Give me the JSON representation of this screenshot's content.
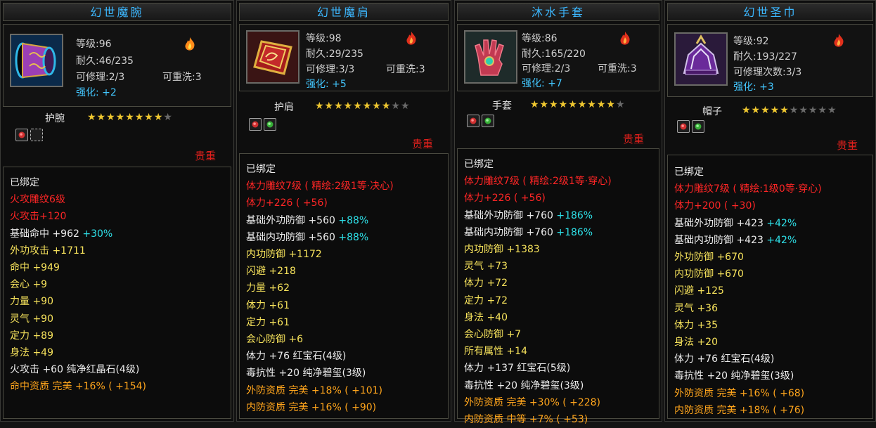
{
  "panels": [
    {
      "title": "幻世魔腕",
      "level": "等级:96",
      "durability": "耐久:46/235",
      "repair": "可修理:2/3",
      "rewash": "可重洗:3",
      "enhance": "强化: +2",
      "slot": "护腕",
      "stars_filled": "★★★★★★★★",
      "stars_empty": "★",
      "rarity": "贵重",
      "bound": "已绑定",
      "lines": [
        {
          "text": "火攻雕纹6级",
          "pct": "",
          "color": "c-red"
        },
        {
          "text": "火攻击+120",
          "pct": "",
          "color": "c-red"
        },
        {
          "text": "基础命中 +962",
          "pct": "+30%",
          "color": "c-white"
        },
        {
          "text": "外功攻击 +1711",
          "pct": "",
          "color": "c-yellow"
        },
        {
          "text": "命中 +949",
          "pct": "",
          "color": "c-yellow"
        },
        {
          "text": "会心 +9",
          "pct": "",
          "color": "c-yellow"
        },
        {
          "text": "力量 +90",
          "pct": "",
          "color": "c-yellow"
        },
        {
          "text": "灵气 +90",
          "pct": "",
          "color": "c-yellow"
        },
        {
          "text": "定力 +89",
          "pct": "",
          "color": "c-yellow"
        },
        {
          "text": "身法 +49",
          "pct": "",
          "color": "c-yellow"
        },
        {
          "text": "火攻击 +60 纯净红晶石(4级)",
          "pct": "",
          "color": "c-white"
        },
        {
          "text": "命中资质  完美 +16% ( +154)",
          "pct": "",
          "color": "c-orange"
        }
      ]
    },
    {
      "title": "幻世魔肩",
      "level": "等级:98",
      "durability": "耐久:29/235",
      "repair": "可修理:3/3",
      "rewash": "可重洗:3",
      "enhance": "强化: +5",
      "slot": "护肩",
      "stars_filled": "★★★★★★★★",
      "stars_empty": "★★",
      "rarity": "贵重",
      "bound": "已绑定",
      "lines": [
        {
          "text": "体力雕纹7级 ( 精绘:2级1等·决心)",
          "pct": "",
          "color": "c-red"
        },
        {
          "text": "体力+226 ( +56)",
          "pct": "",
          "color": "c-red"
        },
        {
          "text": "基础外功防御 +560",
          "pct": "+88%",
          "color": "c-white"
        },
        {
          "text": "基础内功防御 +560",
          "pct": "+88%",
          "color": "c-white"
        },
        {
          "text": "内功防御 +1172",
          "pct": "",
          "color": "c-yellow"
        },
        {
          "text": "闪避 +218",
          "pct": "",
          "color": "c-yellow"
        },
        {
          "text": "力量 +62",
          "pct": "",
          "color": "c-yellow"
        },
        {
          "text": "体力 +61",
          "pct": "",
          "color": "c-yellow"
        },
        {
          "text": "定力 +61",
          "pct": "",
          "color": "c-yellow"
        },
        {
          "text": "会心防御 +6",
          "pct": "",
          "color": "c-yellow"
        },
        {
          "text": "体力 +76 红宝石(4级)",
          "pct": "",
          "color": "c-white"
        },
        {
          "text": "毒抗性 +20 纯净碧玺(3级)",
          "pct": "",
          "color": "c-white"
        },
        {
          "text": "外防资质  完美 +18% ( +101)",
          "pct": "",
          "color": "c-orange"
        },
        {
          "text": "内防资质  完美 +16% ( +90)",
          "pct": "",
          "color": "c-orange"
        }
      ]
    },
    {
      "title": "沐水手套",
      "level": "等级:86",
      "durability": "耐久:165/220",
      "repair": "可修理:2/3",
      "rewash": "可重洗:3",
      "enhance": "强化: +7",
      "slot": "手套",
      "stars_filled": "★★★★★★★★★",
      "stars_empty": "★",
      "rarity": "贵重",
      "bound": "已绑定",
      "lines": [
        {
          "text": "体力雕纹7级 ( 精绘:2级1等·穿心)",
          "pct": "",
          "color": "c-red"
        },
        {
          "text": "体力+226 ( +56)",
          "pct": "",
          "color": "c-red"
        },
        {
          "text": "基础外功防御 +760",
          "pct": "+186%",
          "color": "c-white"
        },
        {
          "text": "基础内功防御 +760",
          "pct": "+186%",
          "color": "c-white"
        },
        {
          "text": "内功防御 +1383",
          "pct": "",
          "color": "c-yellow"
        },
        {
          "text": "灵气 +73",
          "pct": "",
          "color": "c-yellow"
        },
        {
          "text": "体力 +72",
          "pct": "",
          "color": "c-yellow"
        },
        {
          "text": "定力 +72",
          "pct": "",
          "color": "c-yellow"
        },
        {
          "text": "身法 +40",
          "pct": "",
          "color": "c-yellow"
        },
        {
          "text": "会心防御 +7",
          "pct": "",
          "color": "c-yellow"
        },
        {
          "text": "所有属性 +14",
          "pct": "",
          "color": "c-yellow"
        },
        {
          "text": "体力 +137 红宝石(5级)",
          "pct": "",
          "color": "c-white"
        },
        {
          "text": "毒抗性 +20 纯净碧玺(3级)",
          "pct": "",
          "color": "c-white"
        },
        {
          "text": "外防资质  完美 +30% ( +228)",
          "pct": "",
          "color": "c-orange"
        },
        {
          "text": "内防资质  中等 +7% ( +53)",
          "pct": "",
          "color": "c-orange"
        }
      ]
    },
    {
      "title": "幻世圣巾",
      "level": "等级:92",
      "durability": "耐久:193/227",
      "repair": "可修理次数:3/3",
      "rewash": "",
      "enhance": "强化: +3",
      "slot": "帽子",
      "stars_filled": "★★★★★",
      "stars_empty": "★★★★★",
      "rarity": "贵重",
      "bound": "已绑定",
      "lines": [
        {
          "text": "体力雕纹7级 ( 精绘:1级0等·穿心)",
          "pct": "",
          "color": "c-red"
        },
        {
          "text": "体力+200 ( +30)",
          "pct": "",
          "color": "c-red"
        },
        {
          "text": "基础外功防御 +423",
          "pct": "+42%",
          "color": "c-white"
        },
        {
          "text": "基础内功防御 +423",
          "pct": "+42%",
          "color": "c-white"
        },
        {
          "text": "外功防御 +670",
          "pct": "",
          "color": "c-yellow"
        },
        {
          "text": "内功防御 +670",
          "pct": "",
          "color": "c-yellow"
        },
        {
          "text": "闪避 +125",
          "pct": "",
          "color": "c-yellow"
        },
        {
          "text": "灵气 +36",
          "pct": "",
          "color": "c-yellow"
        },
        {
          "text": "体力 +35",
          "pct": "",
          "color": "c-yellow"
        },
        {
          "text": "身法 +20",
          "pct": "",
          "color": "c-yellow"
        },
        {
          "text": "体力 +76 红宝石(4级)",
          "pct": "",
          "color": "c-white"
        },
        {
          "text": "毒抗性 +20 纯净碧玺(3级)",
          "pct": "",
          "color": "c-white"
        },
        {
          "text": "外防资质  完美 +16% ( +68)",
          "pct": "",
          "color": "c-orange"
        },
        {
          "text": "内防资质  完美 +18% ( +76)",
          "pct": "",
          "color": "c-orange"
        }
      ]
    }
  ],
  "colors": {
    "title": "#3cb7ff",
    "enhance": "#43c7ff",
    "rarity": "#e0201c",
    "stat_yellow": "#f7e35c",
    "stat_red": "#ff2626",
    "aptitude": "#ffa51c",
    "percent": "#2ee0e8"
  },
  "icons": [
    "bracer-item-icon",
    "pauldron-item-icon",
    "glove-item-icon",
    "hat-item-icon",
    "fire-element-icon"
  ]
}
